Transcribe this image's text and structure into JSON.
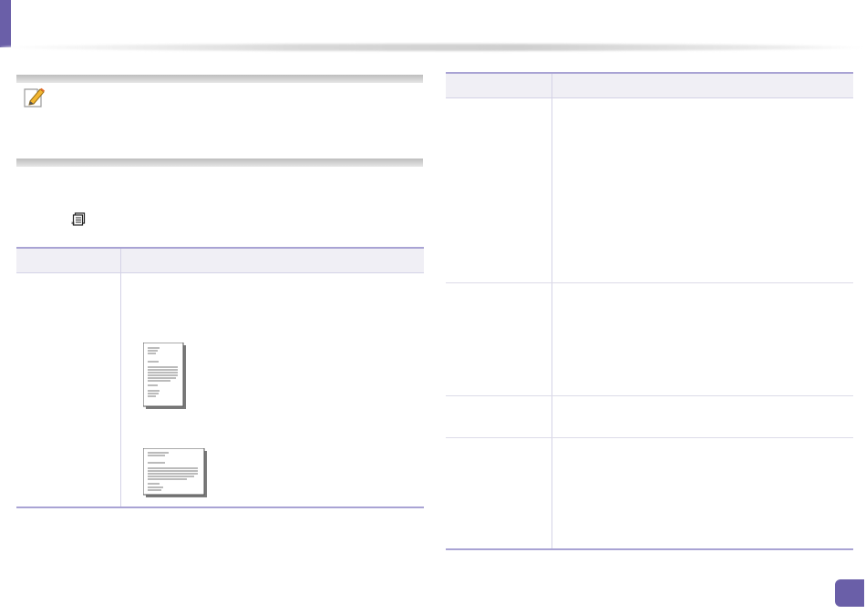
{
  "theme": {
    "accent": "#6a5fa8",
    "table_rule": "#a9a3d4",
    "header_fill": "#f0eff5"
  },
  "icons": {
    "note": "note-pencil-icon",
    "menu": "menu-icon",
    "portrait": "portrait-document-icon",
    "landscape": "landscape-document-icon"
  }
}
